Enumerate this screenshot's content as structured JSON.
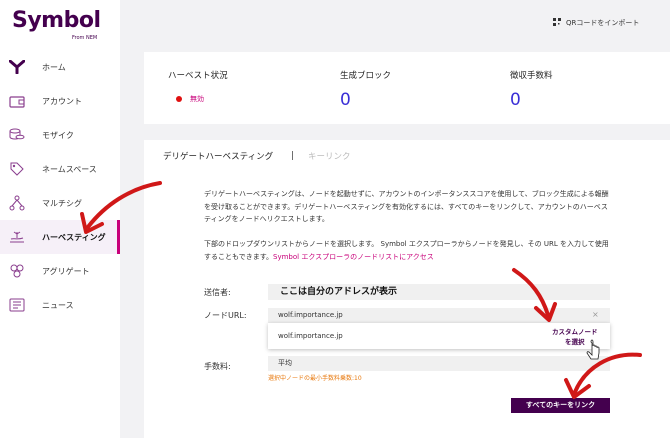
{
  "brand": {
    "name": "Symbol",
    "sub": "From NEM"
  },
  "nav": {
    "items": [
      {
        "label": "ホーム",
        "icon": "symbol-logo-icon"
      },
      {
        "label": "アカウント",
        "icon": "wallet-icon"
      },
      {
        "label": "モザイク",
        "icon": "coins-icon"
      },
      {
        "label": "ネームスペース",
        "icon": "tag-icon"
      },
      {
        "label": "マルチシグ",
        "icon": "multisig-icon"
      },
      {
        "label": "ハーベスティング",
        "icon": "harvest-icon"
      },
      {
        "label": "アグリゲート",
        "icon": "aggregate-icon"
      },
      {
        "label": "ニュース",
        "icon": "news-icon"
      }
    ],
    "active_index": 5
  },
  "header": {
    "qr_import": "QRコードをインポート"
  },
  "status": {
    "harvest_label": "ハーベスト状況",
    "harvest_value": "無効",
    "blocks_label": "生成ブロック",
    "blocks_value": "0",
    "fees_label": "徴収手数料",
    "fees_value": "0"
  },
  "tabs": {
    "delegated": "デリゲートハーベスティング",
    "separator": "|",
    "keylink": "キーリンク"
  },
  "description": {
    "para1": "デリゲートハーベスティングは、ノードを起動せずに、アカウントのインポータンススコアを使用して、ブロック生成による報酬を受け取ることができます。デリゲートハーベスティングを有効化するには、すべてのキーをリンクして、アカウントのハーベスティングをノードへリクエストします。",
    "para2": "下部のドロップダウンリストからノードを選択します。 Symbol エクスプローラからノードを発見し、その URL を入力して使用することもできます。",
    "para2_link": "Symbol エクスプローラのノードリストにアクセス"
  },
  "form": {
    "sender_label": "送信者:",
    "sender_value": "ここは自分のアドレスが表示",
    "node_label": "ノードURL:",
    "node_value": "wolf.importance.jp",
    "node_option": "wolf.importance.jp",
    "custom_node_line1": "カスタムノード",
    "custom_node_line2": "を選択",
    "fee_label": "手数料:",
    "fee_value": "平均",
    "fee_hint": "選択中ノードの最小手数料乗数:10",
    "link_button": "すべてのキーをリンク"
  },
  "colors": {
    "brand": "#44004e",
    "accent": "#c8007a",
    "value": "#3a2fd6",
    "status_dot": "#e01010",
    "annotation": "#d01818",
    "hint": "#e87a10"
  }
}
